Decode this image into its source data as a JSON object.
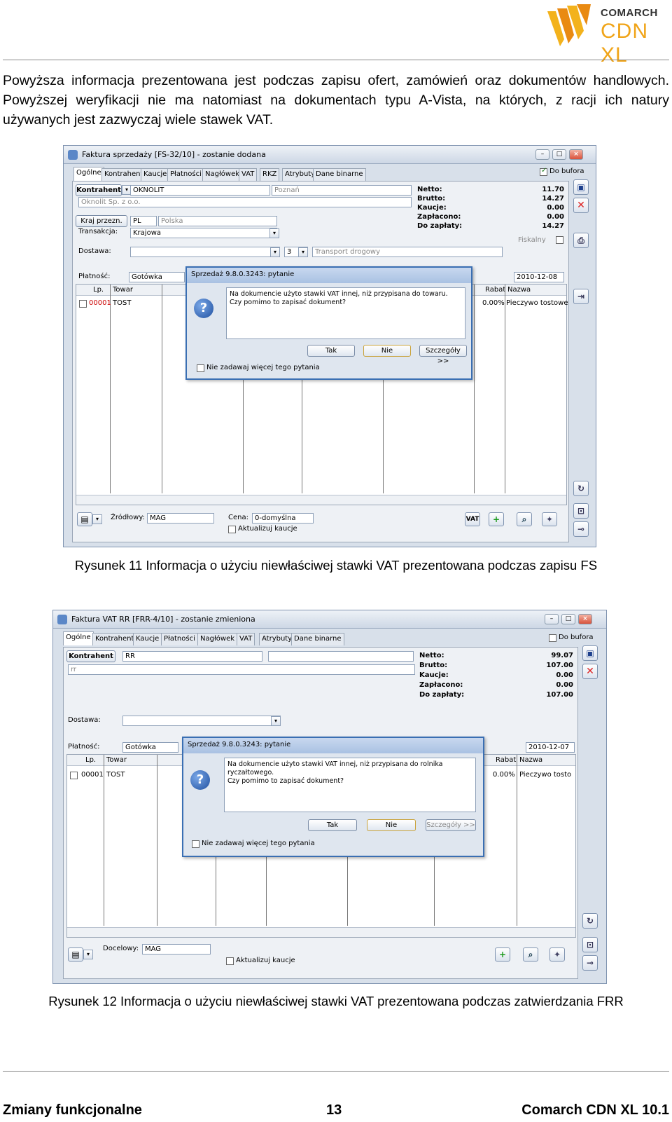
{
  "header": {
    "brand": "COMARCH",
    "product": "CDN XL"
  },
  "intro_text": "Powyższa informacja prezentowana jest podczas zapisu ofert, zamówień oraz dokumentów handlowych. Powyższej weryfikacji nie ma natomiast na dokumentach typu A-Vista, na których, z racji ich natury używanych jest zazwyczaj wiele stawek VAT.",
  "figure1": {
    "window_title": "Faktura sprzedaży [FS-32/10] - zostanie dodana",
    "tabs": [
      "Ogólne",
      "Kontrahent",
      "Kaucje",
      "Płatności",
      "Nagłówek",
      "VAT",
      "RKZ",
      "Atrybuty",
      "Dane binarne"
    ],
    "do_bufora": "Do bufora",
    "kontrahent_btn": "Kontrahent",
    "kontrahent_code": "OKNOLIT",
    "kontrahent_name": "Oknolit Sp. z o.o.",
    "city": "Poznań",
    "kraj_btn": "Kraj przezn.",
    "kraj_code": "PL",
    "kraj_name": "Polska",
    "transakcja_label": "Transakcja:",
    "transakcja_value": "Krajowa",
    "dostawa_label": "Dostawa:",
    "dostawa_num": "3",
    "dostawa_value": "Transport drogowy",
    "platnosc_label": "Płatność:",
    "platnosc_value": "Gotówka",
    "date": "2010-12-08",
    "fiskalny": "Fiskalny",
    "summary": [
      {
        "k": "Netto:",
        "v": "11.70"
      },
      {
        "k": "Brutto:",
        "v": "14.27"
      },
      {
        "k": "Kaucje:",
        "v": "0.00"
      },
      {
        "k": "Zapłacono:",
        "v": "0.00"
      },
      {
        "k": "Do zapłaty:",
        "v": "14.27"
      }
    ],
    "grid_cols": [
      "Lp.",
      "Towar",
      "Rabat",
      "Nazwa"
    ],
    "row": {
      "lp": "00001",
      "towar": "TOST",
      "rabat": "0.00%",
      "nazwa": "Pieczywo tostowe"
    },
    "zrodlowy_label": "Źródłowy:",
    "zrodlowy_value": "MAG",
    "cena_label": "Cena:",
    "cena_value": "0-domyślna",
    "aktualizuj": "Aktualizuj kaucje",
    "vat_btn": "VAT",
    "dialog": {
      "title": "Sprzedaż 9.8.0.3243: pytanie",
      "line1": "Na dokumencie użyto stawki VAT innej, niż przypisana do towaru.",
      "line2": "Czy pomimo to zapisać dokument?",
      "tak": "Tak",
      "nie": "Nie",
      "szczegoly": "Szczegóły >>",
      "nie_zadawaj": "Nie zadawaj więcej tego pytania"
    }
  },
  "caption1": "Rysunek 11 Informacja o użyciu niewłaściwej stawki VAT prezentowana podczas zapisu FS",
  "figure2": {
    "window_title": "Faktura VAT RR [FRR-4/10] - zostanie zmieniona",
    "tabs": [
      "Ogólne",
      "Kontrahent",
      "Kaucje",
      "Płatności",
      "Nagłówek",
      "VAT",
      "Atrybuty",
      "Dane binarne"
    ],
    "do_bufora": "Do bufora",
    "kontrahent_btn": "Kontrahent",
    "kontrahent_code": "RR",
    "kontrahent_name": "rr",
    "dostawa_label": "Dostawa:",
    "platnosc_label": "Płatność:",
    "platnosc_value": "Gotówka",
    "date": "2010-12-07",
    "summary": [
      {
        "k": "Netto:",
        "v": "99.07"
      },
      {
        "k": "Brutto:",
        "v": "107.00"
      },
      {
        "k": "Kaucje:",
        "v": "0.00"
      },
      {
        "k": "Zapłacono:",
        "v": "0.00"
      },
      {
        "k": "Do zapłaty:",
        "v": "107.00"
      }
    ],
    "grid_cols": [
      "Lp.",
      "Towar",
      "Rabat",
      "Nazwa"
    ],
    "row": {
      "lp": "00001",
      "towar": "TOST",
      "rabat": "0.00%",
      "nazwa": "Pieczywo tosto"
    },
    "docelowy_label": "Docelowy:",
    "docelowy_value": "MAG",
    "aktualizuj": "Aktualizuj kaucje",
    "dialog": {
      "title": "Sprzedaż 9.8.0.3243: pytanie",
      "line1": "Na dokumencie użyto stawki VAT innej, niż przypisana do rolnika",
      "line2": "ryczałtowego.",
      "line3": "Czy pomimo to zapisać dokument?",
      "tak": "Tak",
      "nie": "Nie",
      "szczegoly": "Szczegóły >>",
      "nie_zadawaj": "Nie zadawaj więcej tego pytania"
    }
  },
  "caption2": "Rysunek 12 Informacja o użyciu niewłaściwej stawki VAT prezentowana podczas zatwierdzania FRR",
  "footer": {
    "left": "Zmiany funkcjonalne",
    "center": "13",
    "right": "Comarch CDN XL 10.1"
  }
}
